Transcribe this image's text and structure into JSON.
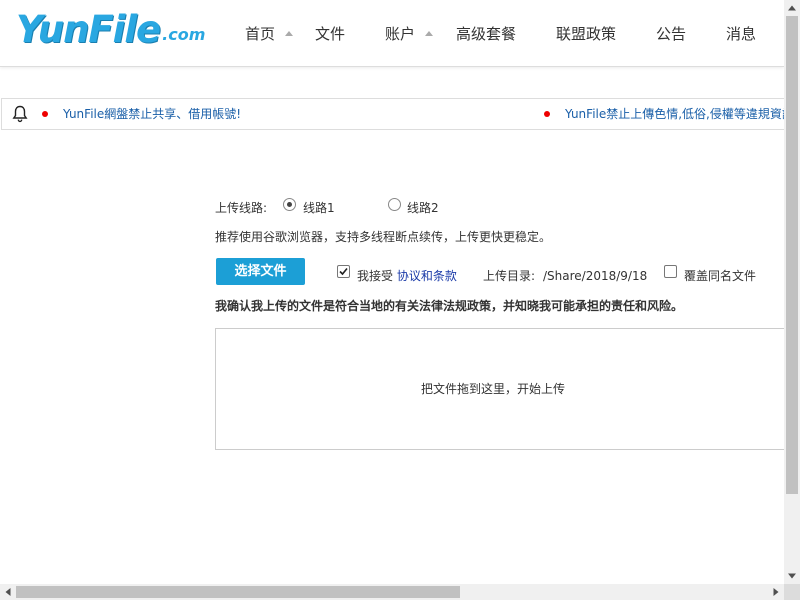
{
  "header": {
    "logo": "YunFile",
    "logo_suffix": ".com",
    "nav": [
      {
        "label": "首页",
        "has_caret": true
      },
      {
        "label": "文件",
        "has_caret": false
      },
      {
        "label": "账户",
        "has_caret": true
      },
      {
        "label": "高级套餐",
        "has_caret": false
      },
      {
        "label": "联盟政策",
        "has_caret": false
      },
      {
        "label": "公告",
        "has_caret": false
      },
      {
        "label": "消息",
        "has_caret": false
      }
    ]
  },
  "notice": {
    "icon": "bell-icon",
    "items": [
      "YunFile網盤禁止共享、借用帳號!",
      "YunFile禁止上傳色情,低俗,侵權等違規資訊"
    ]
  },
  "upload": {
    "route_label": "上传线路:",
    "routes": [
      {
        "label": "线路1",
        "checked": true
      },
      {
        "label": "线路2",
        "checked": false
      }
    ],
    "hint": "推荐使用谷歌浏览器，支持多线程断点续传，上传更快更稳定。",
    "select_button": "选择文件",
    "accept_prefix": "我接受",
    "accept_link": "协议和条款",
    "accept_checked": true,
    "dir_label": "上传目录:",
    "dir_value": "/Share/2018/9/18",
    "overwrite_label": "覆盖同名文件",
    "overwrite_checked": false,
    "confirm_note": "我确认我上传的文件是符合当地的有关法律法规政策，并知晓我可能承担的责任和风险。",
    "dropzone_text": "把文件拖到这里，开始上传"
  },
  "colors": {
    "accent": "#1c9fd6",
    "logo": "#29a7e1",
    "link": "#1a3aa8",
    "notice_text": "#1a5fa8",
    "notice_dot": "#ee0000"
  }
}
